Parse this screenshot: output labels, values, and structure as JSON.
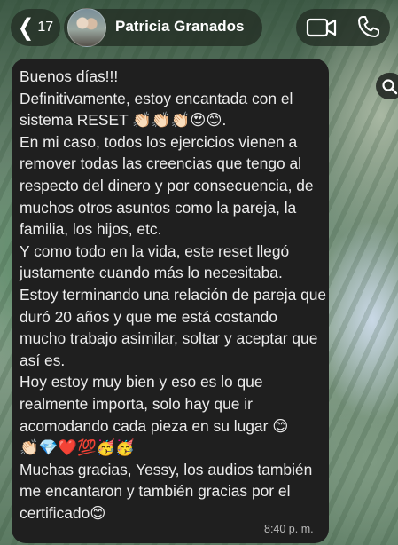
{
  "header": {
    "back_count": "17",
    "contact_name": "Patricia Granados"
  },
  "message": {
    "text": "Buenos días!!!\nDefinitivamente, estoy encantada con el sistema RESET 👏🏻👏🏻👏🏻😍😊.\nEn mi caso, todos los ejercicios vienen a remover todas las creencias que tengo al respecto del dinero y por consecuencia, de muchos otros asuntos como la pareja, la familia, los hijos, etc.\nY como todo en la vida, este reset llegó justamente cuando más lo necesitaba.\nEstoy terminando una relación de pareja que duró 20 años y que me está costando mucho trabajo asimilar, soltar y aceptar que así es.\nHoy estoy muy bien y eso es lo que realmente importa, solo hay que ir acomodando cada pieza en su lugar 😊\n👏🏻💎❤️💯🥳🥳\nMuchas gracias, Yessy, los audios también me encantaron y también gracias por el certificado😊",
    "timestamp": "8:40 p. m."
  },
  "colors": {
    "bubble": "#1f1f1f",
    "text": "#ececec",
    "header_pill": "#243026"
  },
  "icons": {
    "back": "chevron-left-icon",
    "video": "video-camera-icon",
    "phone": "phone-icon",
    "search": "search-icon"
  }
}
